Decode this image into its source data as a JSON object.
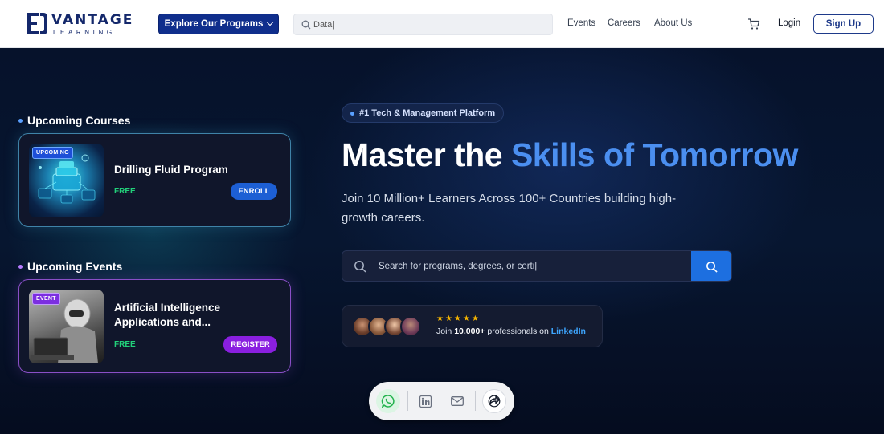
{
  "header": {
    "logo_name": "VANTAGE",
    "logo_sub": "LEARNING",
    "explore_label": "Explore Our Programs",
    "search_value": "Data|",
    "nav": [
      "Events",
      "Careers",
      "About Us"
    ],
    "login_label": "Login",
    "signup_label": "Sign Up"
  },
  "hero": {
    "courses_heading": "Upcoming Courses",
    "course": {
      "badge": "UPCOMING",
      "title": "Drilling Fluid Program",
      "price": "FREE",
      "action": "ENROLL"
    },
    "events_heading": "Upcoming Events",
    "event": {
      "badge": "EVENT",
      "title": "Artificial Intelligence Applications and...",
      "price": "FREE",
      "action": "REGISTER"
    },
    "pill": "#1 Tech & Management Platform",
    "headline_plain": "Master the ",
    "headline_accent": "Skills of Tomorrow",
    "subline": "Join 10 Million+ Learners Across 100+ Countries building high-growth careers.",
    "search_placeholder": "Search for programs, degrees, or certi|",
    "stars": "★★★★★",
    "join_prefix": "Join ",
    "join_bold": "10,000+",
    "join_middle": " professionals on ",
    "join_link": "LinkedIn"
  },
  "colors": {
    "brand_navy": "#0f2e8c",
    "accent_blue": "#4b8ff0",
    "free_green": "#22d07a",
    "register_purple": "#8a1fe0",
    "star_gold": "#f5b400"
  },
  "icons": {
    "cart": "cart-icon",
    "search": "search-icon",
    "whatsapp": "whatsapp-icon",
    "linkedin": "linkedin-icon",
    "mail": "mail-icon",
    "share": "share-icon"
  }
}
